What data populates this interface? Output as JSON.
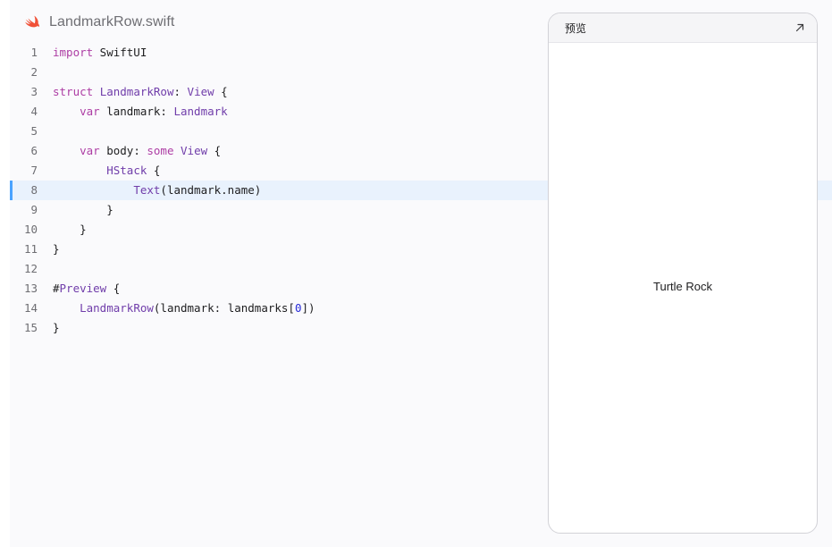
{
  "file": {
    "name": "LandmarkRow.swift",
    "icon": "swift-logo-icon",
    "icon_color": "#f05138"
  },
  "code": {
    "highlighted_line": 8,
    "lines": [
      {
        "n": "1",
        "tokens": [
          [
            "kw",
            "import"
          ],
          [
            "pl",
            " SwiftUI"
          ]
        ]
      },
      {
        "n": "2",
        "tokens": []
      },
      {
        "n": "3",
        "tokens": [
          [
            "kw",
            "struct"
          ],
          [
            "pl",
            " "
          ],
          [
            "ty",
            "LandmarkRow"
          ],
          [
            "pl",
            ": "
          ],
          [
            "ty",
            "View"
          ],
          [
            "pl",
            " {"
          ]
        ]
      },
      {
        "n": "4",
        "tokens": [
          [
            "pl",
            "    "
          ],
          [
            "kw",
            "var"
          ],
          [
            "pl",
            " landmark: "
          ],
          [
            "ty",
            "Landmark"
          ]
        ]
      },
      {
        "n": "5",
        "tokens": []
      },
      {
        "n": "6",
        "tokens": [
          [
            "pl",
            "    "
          ],
          [
            "kw",
            "var"
          ],
          [
            "pl",
            " body: "
          ],
          [
            "kw",
            "some"
          ],
          [
            "pl",
            " "
          ],
          [
            "ty",
            "View"
          ],
          [
            "pl",
            " {"
          ]
        ]
      },
      {
        "n": "7",
        "tokens": [
          [
            "pl",
            "        "
          ],
          [
            "ty",
            "HStack"
          ],
          [
            "pl",
            " {"
          ]
        ]
      },
      {
        "n": "8",
        "tokens": [
          [
            "pl",
            "            "
          ],
          [
            "ty",
            "Text"
          ],
          [
            "pl",
            "(landmark.name)"
          ]
        ]
      },
      {
        "n": "9",
        "tokens": [
          [
            "pl",
            "        }"
          ]
        ]
      },
      {
        "n": "10",
        "tokens": [
          [
            "pl",
            "    }"
          ]
        ]
      },
      {
        "n": "11",
        "tokens": [
          [
            "pl",
            "}"
          ]
        ]
      },
      {
        "n": "12",
        "tokens": []
      },
      {
        "n": "13",
        "tokens": [
          [
            "pl",
            "#"
          ],
          [
            "ty",
            "Preview"
          ],
          [
            "pl",
            " {"
          ]
        ]
      },
      {
        "n": "14",
        "tokens": [
          [
            "pl",
            "    "
          ],
          [
            "ty",
            "LandmarkRow"
          ],
          [
            "pl",
            "(landmark: landmarks["
          ],
          [
            "num",
            "0"
          ],
          [
            "pl",
            "])"
          ]
        ]
      },
      {
        "n": "15",
        "tokens": [
          [
            "pl",
            "}"
          ]
        ]
      }
    ]
  },
  "preview": {
    "title": "预览",
    "expand_icon": "expand-arrow-icon",
    "content_text": "Turtle Rock"
  },
  "colors": {
    "keyword": "#ad3da4",
    "type": "#703daa",
    "number": "#272ad8",
    "highlight_bg": "#e9f2fd",
    "highlight_bar": "#4aa3ff"
  }
}
